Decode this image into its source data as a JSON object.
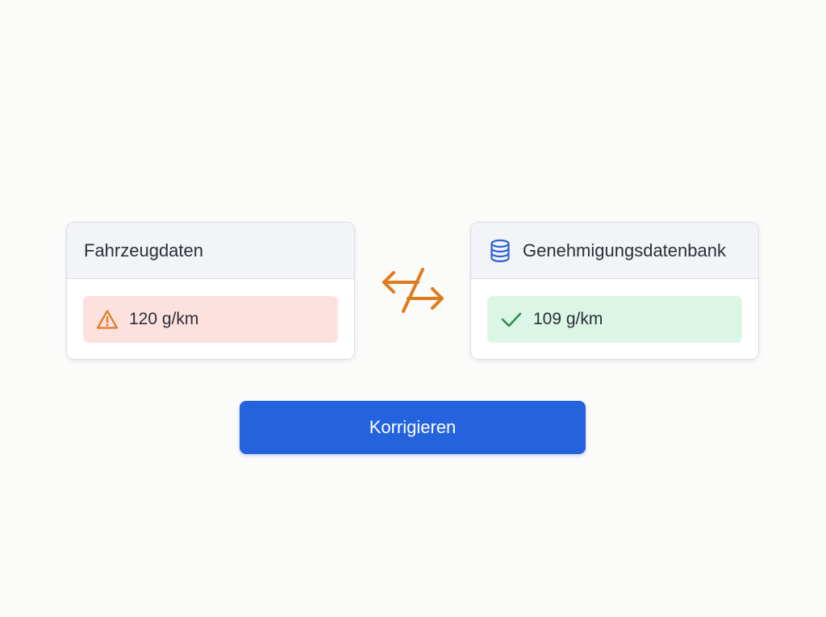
{
  "vehicle_card": {
    "title": "Fahrzeugdaten",
    "value": "120 g/km",
    "status_icon": "warning-triangle-icon",
    "status": "error"
  },
  "approval_card": {
    "title": "Genehmigungsdatenbank",
    "header_icon": "database-icon",
    "value": "109 g/km",
    "status_icon": "checkmark-icon",
    "status": "ok"
  },
  "comparison_icon": "mismatch-arrows-icon",
  "actions": {
    "correct_label": "Korrigieren"
  },
  "colors": {
    "accent": "#2563de",
    "error_bg": "#fde1df",
    "success_bg": "#dbf6e6",
    "warning": "#e07b1a",
    "success": "#2f8f4f",
    "database_icon": "#2d62d8"
  }
}
